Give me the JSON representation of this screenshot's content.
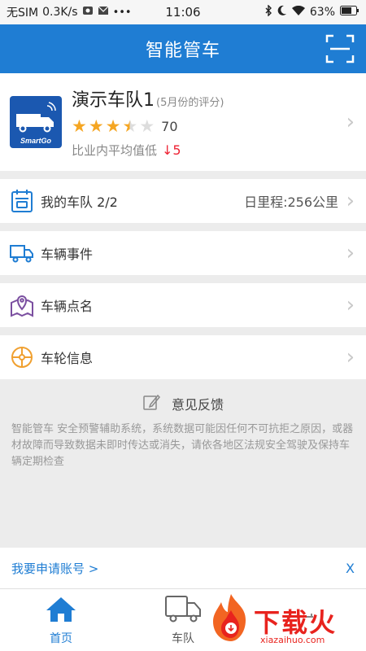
{
  "status_bar": {
    "carrier": "无SIM",
    "speed": "0.3K/s",
    "time": "11:06",
    "battery": "63%",
    "icons": [
      "box-icon",
      "mail-icon",
      "more-icon",
      "bluetooth-icon",
      "moon-icon",
      "wifi-icon",
      "battery-icon"
    ]
  },
  "header": {
    "title": "智能管车",
    "scan_icon": "scan-icon"
  },
  "team_card": {
    "name": "演示车队1",
    "period": "(5月份的评分)",
    "rating": 3.5,
    "rating_max": 5,
    "score": "70",
    "compare_label": "比业内平均值低",
    "compare_delta": "↓5",
    "logo_text": "SmartGo"
  },
  "menu": {
    "my_team": {
      "label": "我的车队 2/2",
      "extra": "日里程:256公里"
    },
    "events": {
      "label": "车辆事件"
    },
    "roll_call": {
      "label": "车辆点名"
    },
    "wheels": {
      "label": "车轮信息"
    }
  },
  "feedback": {
    "label": "意见反馈",
    "disclaimer": "智能管车 安全预警辅助系统，系统数据可能因任何不可抗拒之原因，或器材故障而导致数据未即时传达或消失，请依各地区法规安全驾驶及保持车辆定期检查"
  },
  "apply": {
    "link": "我要申请账号 >",
    "close": "X"
  },
  "tabs": [
    {
      "label": "首页",
      "icon": "home-icon",
      "active": true
    },
    {
      "label": "车队",
      "icon": "truck-icon",
      "active": false
    },
    {
      "label": "",
      "icon": "partial-icon",
      "active": false
    }
  ],
  "watermark": {
    "text": "下载火",
    "sub": "xiazaihuo.com"
  },
  "colors": {
    "primary": "#1f7dd3",
    "star": "#f5a623",
    "alert": "#e23",
    "watermark": "#e8231e"
  }
}
